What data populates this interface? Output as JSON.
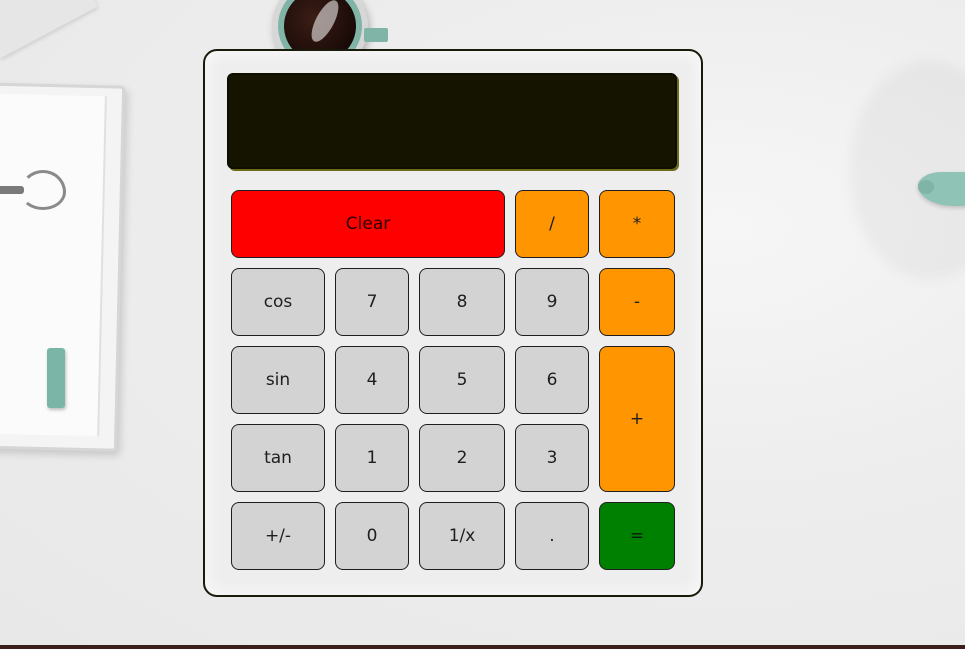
{
  "calculator": {
    "display_value": "",
    "buttons": {
      "clear": "Clear",
      "divide": "/",
      "multiply": "*",
      "cos": "cos",
      "seven": "7",
      "eight": "8",
      "nine": "9",
      "minus": "-",
      "sin": "sin",
      "four": "4",
      "five": "5",
      "six": "6",
      "plus": "+",
      "tan": "tan",
      "one": "1",
      "two": "2",
      "three": "3",
      "negate": "+/-",
      "zero": "0",
      "reciprocal": "1/x",
      "decimal": ".",
      "equals": "="
    }
  },
  "colors": {
    "clear_button": "#ff0000",
    "operator_button": "#ff9500",
    "equals_button": "#008000",
    "number_button": "#d3d3d3",
    "display": "#141400"
  }
}
